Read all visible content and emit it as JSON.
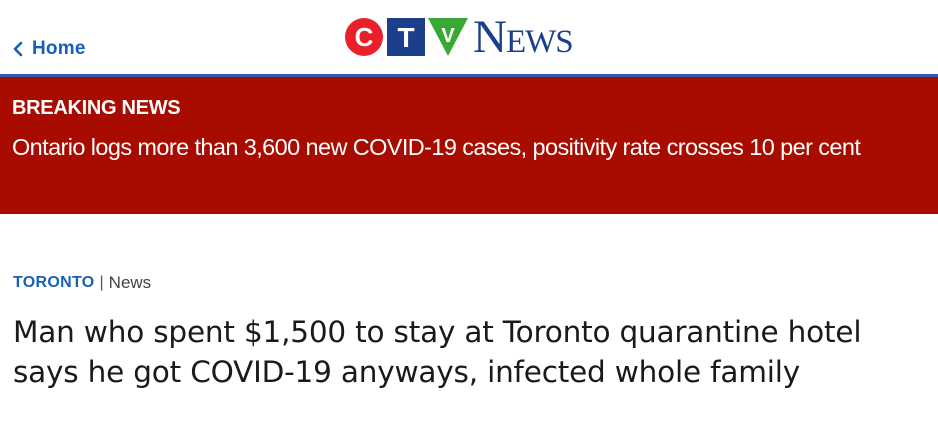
{
  "header": {
    "home_label": "Home",
    "logo": {
      "letters": [
        "C",
        "T",
        "V"
      ],
      "wordmark": "News",
      "colors": {
        "red": "#e8202a",
        "blue": "#1b3f8a",
        "green": "#3aa835"
      }
    }
  },
  "breaking": {
    "label": "BREAKING NEWS",
    "headline": "Ontario logs more than 3,600 new COVID-19 cases, positivity rate crosses 10 per cent",
    "background": "#a80b00"
  },
  "article": {
    "section": "TORONTO",
    "separator": "|",
    "type": "News",
    "headline": "Man who spent $1,500 to stay at Toronto quarantine hotel says he got COVID-19 anyways, infected whole family"
  },
  "icons": {
    "back": "chevron-left-icon"
  }
}
